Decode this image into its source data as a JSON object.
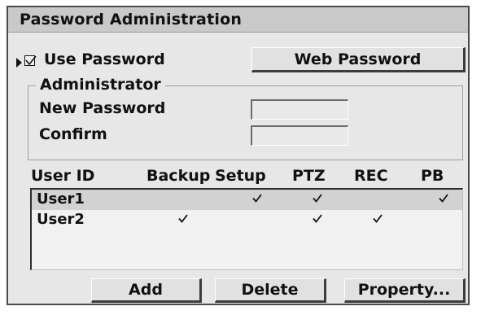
{
  "window": {
    "title": "Password Administration"
  },
  "use_password": {
    "label": "Use Password",
    "checked": true
  },
  "web_password_button": "Web Password",
  "administrator": {
    "legend": "Administrator",
    "new_password_label": "New Password",
    "confirm_label": "Confirm",
    "new_password_value": "",
    "confirm_value": ""
  },
  "user_table": {
    "columns": [
      "User ID",
      "Backup",
      "Setup",
      "PTZ",
      "REC",
      "PB"
    ],
    "rows": [
      {
        "user": "User1",
        "selected": true,
        "backup": false,
        "setup": true,
        "ptz": true,
        "rec": false,
        "pb": true
      },
      {
        "user": "User2",
        "selected": false,
        "backup": true,
        "setup": false,
        "ptz": true,
        "rec": true,
        "pb": false
      }
    ]
  },
  "buttons": {
    "add": "Add",
    "delete": "Delete",
    "property": "Property..."
  },
  "colors": {
    "window_bg": "#e7e7e7",
    "titlebar_bg": "#c9c9c9",
    "list_bg": "#f1f1f1",
    "selected_row": "#d2d2d2"
  }
}
